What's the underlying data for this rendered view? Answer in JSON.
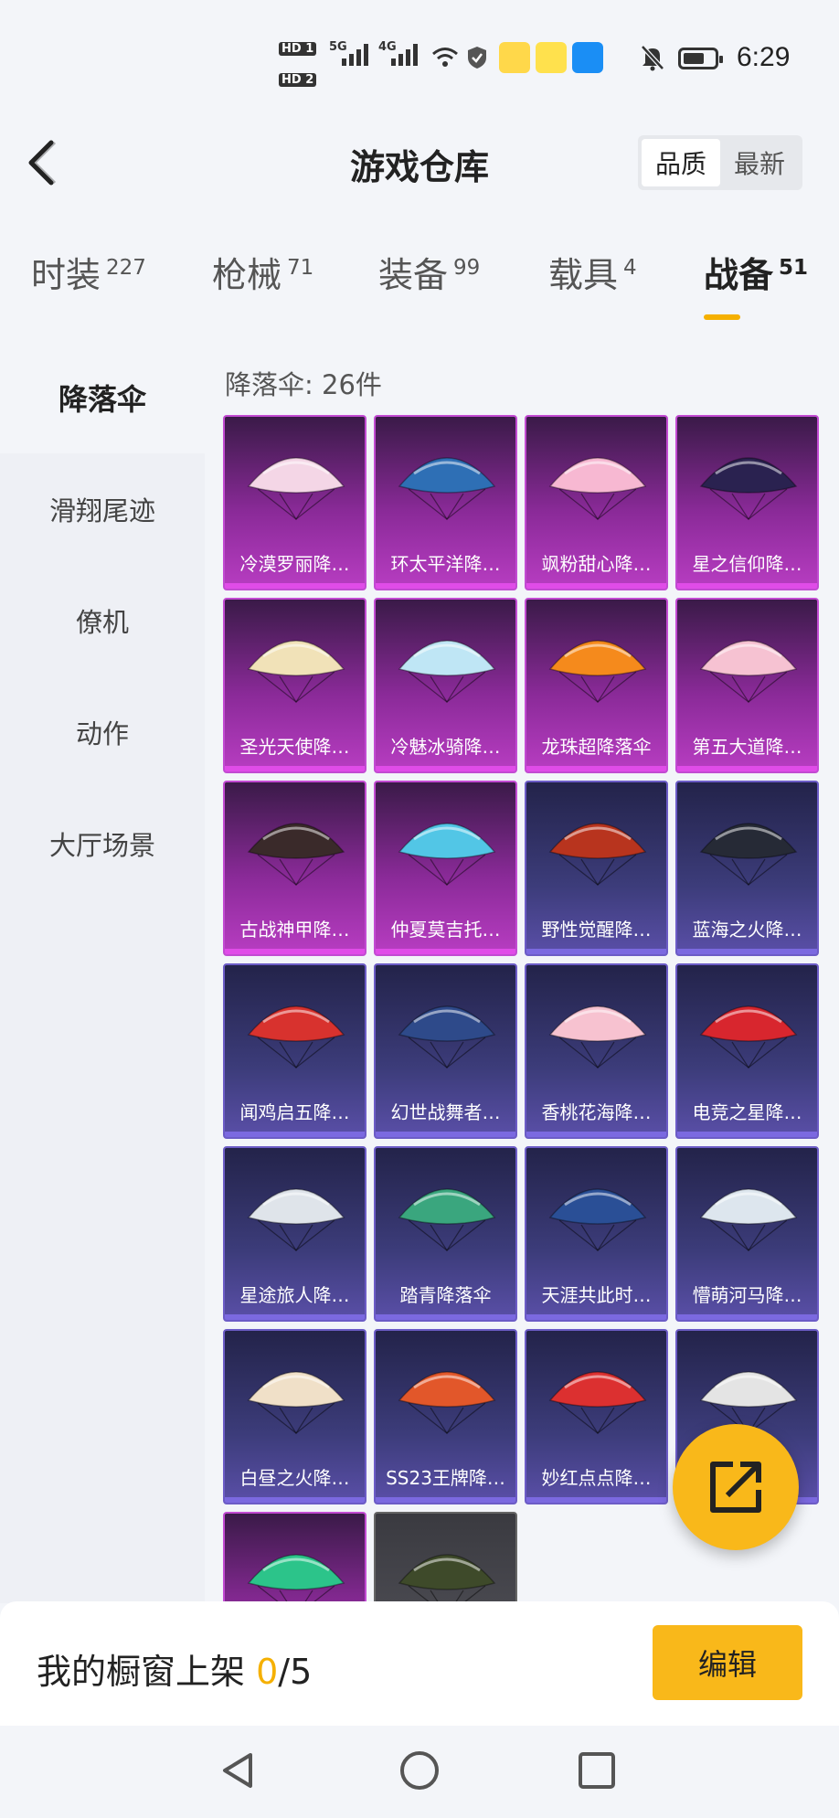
{
  "status_bar": {
    "time": "6:29",
    "sim1": "HD 1",
    "sim2": "HD 2",
    "net1": "5G",
    "net2": "4G"
  },
  "header": {
    "title": "游戏仓库",
    "sort_quality": "品质",
    "sort_newest": "最新"
  },
  "tabs": [
    {
      "label": "时装",
      "count": "227"
    },
    {
      "label": "枪械",
      "count": "71"
    },
    {
      "label": "装备",
      "count": "99"
    },
    {
      "label": "载具",
      "count": "4"
    },
    {
      "label": "战备",
      "count": "51"
    }
  ],
  "sidebar": [
    {
      "label": "降落伞"
    },
    {
      "label": "滑翔尾迹"
    },
    {
      "label": "僚机"
    },
    {
      "label": "动作"
    },
    {
      "label": "大厅场景"
    }
  ],
  "grid": {
    "count_label": "降落伞: 26件",
    "items": [
      {
        "label": "冷漠罗丽降…",
        "rarity": "purple",
        "color": "#f4d6e6"
      },
      {
        "label": "环太平洋降…",
        "rarity": "purple",
        "color": "#2e6fb5"
      },
      {
        "label": "飒粉甜心降…",
        "rarity": "purple",
        "color": "#f7b8d2"
      },
      {
        "label": "星之信仰降…",
        "rarity": "purple",
        "color": "#2a2250"
      },
      {
        "label": "圣光天使降…",
        "rarity": "purple",
        "color": "#f1e2b8"
      },
      {
        "label": "冷魅冰骑降…",
        "rarity": "purple",
        "color": "#bfe6f5"
      },
      {
        "label": "龙珠超降落伞",
        "rarity": "purple",
        "color": "#f58a1c"
      },
      {
        "label": "第五大道降…",
        "rarity": "purple",
        "color": "#f6c2d2"
      },
      {
        "label": "古战神甲降…",
        "rarity": "purple",
        "color": "#3a2a2a"
      },
      {
        "label": "仲夏莫吉托…",
        "rarity": "purple",
        "color": "#52c6e6"
      },
      {
        "label": "野性觉醒降…",
        "rarity": "blue",
        "color": "#b8341e"
      },
      {
        "label": "蓝海之火降…",
        "rarity": "blue",
        "color": "#262a36"
      },
      {
        "label": "闻鸡启五降…",
        "rarity": "blue",
        "color": "#d8322e"
      },
      {
        "label": "幻世战舞者…",
        "rarity": "blue",
        "color": "#2e4a8a"
      },
      {
        "label": "香桃花海降…",
        "rarity": "blue",
        "color": "#f7c2d0"
      },
      {
        "label": "电竞之星降…",
        "rarity": "blue",
        "color": "#d8262e"
      },
      {
        "label": "星途旅人降…",
        "rarity": "blue",
        "color": "#dfe4ea"
      },
      {
        "label": "踏青降落伞",
        "rarity": "blue",
        "color": "#3aa67e"
      },
      {
        "label": "天涯共此时…",
        "rarity": "blue",
        "color": "#2a4f96"
      },
      {
        "label": "懵萌河马降…",
        "rarity": "blue",
        "color": "#dde6ee"
      },
      {
        "label": "白昼之火降…",
        "rarity": "blue",
        "color": "#f0e0c8"
      },
      {
        "label": "SS23王牌降…",
        "rarity": "blue",
        "color": "#e2572a"
      },
      {
        "label": "妙红点点降…",
        "rarity": "blue",
        "color": "#dc3030"
      },
      {
        "label": "",
        "rarity": "blue",
        "color": "#e4e4e4"
      },
      {
        "label": "",
        "rarity": "purple",
        "color": "#2cc48a"
      },
      {
        "label": "",
        "rarity": "grey",
        "color": "#3e4a2a"
      }
    ]
  },
  "bottom_bar": {
    "showcase_prefix": "我的橱窗上架 ",
    "showcase_current": "0",
    "showcase_suffix": "/5",
    "edit_label": "编辑"
  },
  "colors": {
    "accent": "#f9b81a",
    "purple_rarity": "#c24bd2",
    "blue_rarity": "#6c5cc6"
  }
}
